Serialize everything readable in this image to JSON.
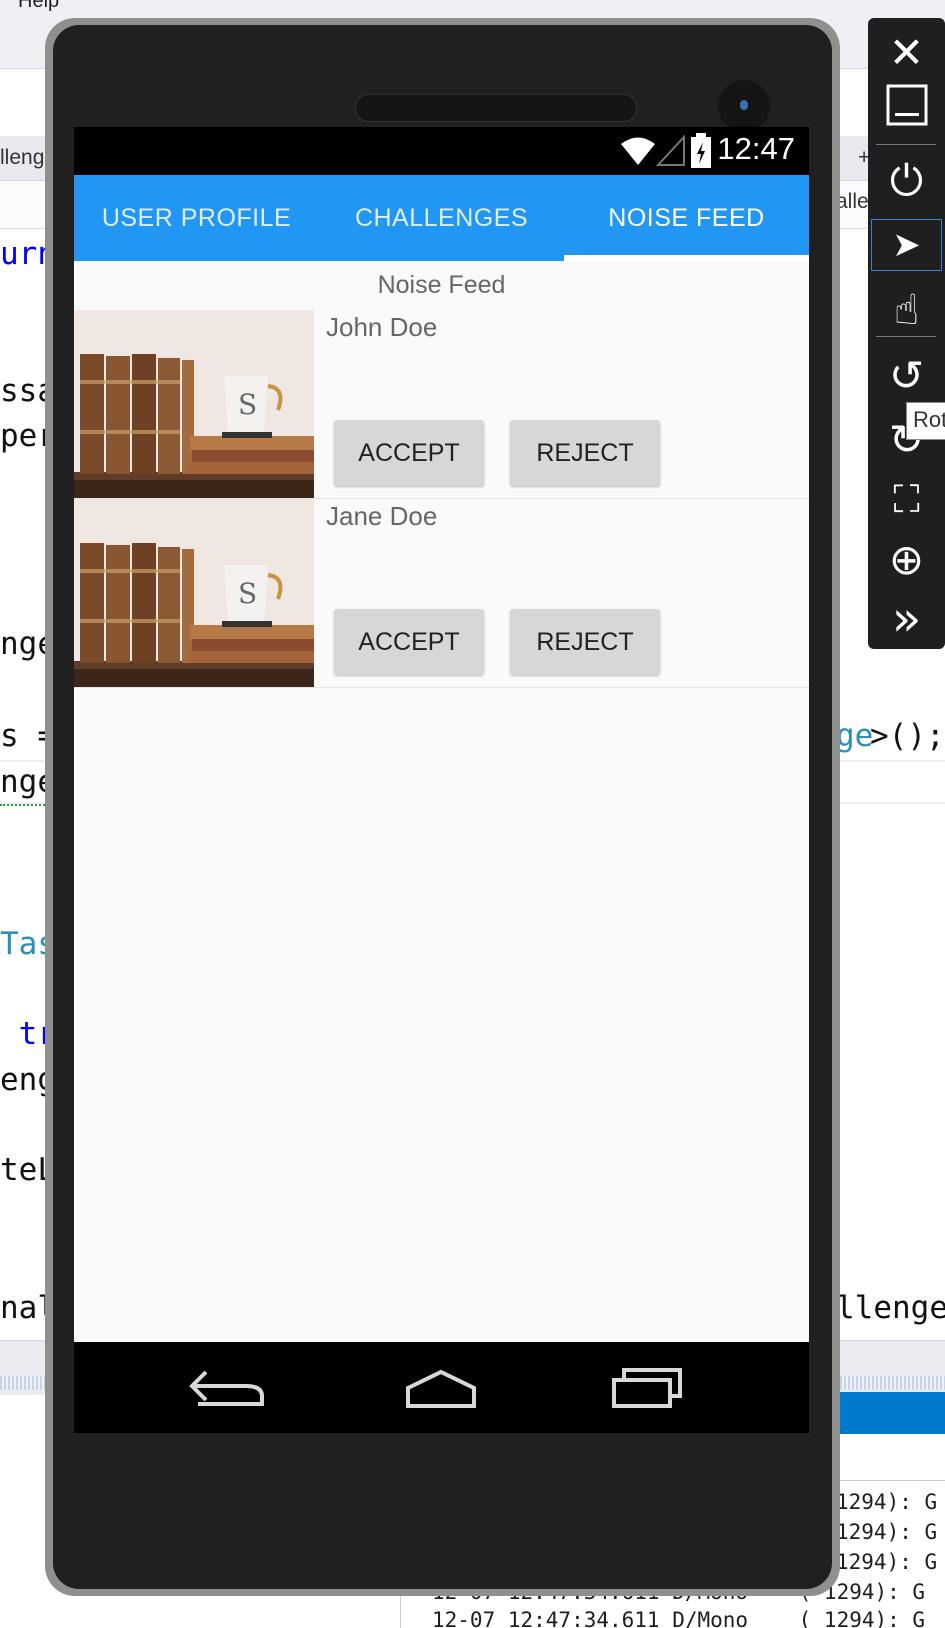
{
  "ide": {
    "menu_label": "Help",
    "tab_left": "lleng",
    "tab_right": "+",
    "nav_right": "alle",
    "code_lines": [
      {
        "text": "urn",
        "color": "blue",
        "side": "left"
      },
      {
        "text": "ssa",
        "color": "black",
        "side": "left"
      },
      {
        "text": "per",
        "color": "black",
        "side": "left"
      },
      {
        "text": "nge",
        "color": "black",
        "side": "left"
      },
      {
        "text": "s =",
        "color": "black",
        "side": "left"
      },
      {
        "text": "nge",
        "color": "black",
        "side": "left"
      },
      {
        "text": "Tas",
        "color": "teal",
        "side": "left"
      },
      {
        "text": " tr",
        "color": "blue",
        "side": "left"
      },
      {
        "text": "eng",
        "color": "black",
        "side": "left"
      },
      {
        "text": "teL",
        "color": "black",
        "side": "left"
      },
      {
        "text": "nal",
        "color": "black",
        "side": "left"
      }
    ],
    "code_right_1_teal": "ge",
    "code_right_1_black": ">();",
    "code_right_2": "llenge",
    "output_lines": [
      "1294): G",
      "1294): G",
      "1294): G",
      "12-07 12:47:34.611 D/Mono    ( 1294): G",
      "12-07 12:47:34.611 D/Mono    ( 1294): G"
    ],
    "tooltip": "Rot"
  },
  "toolbar": {
    "buttons": [
      {
        "name": "close-icon",
        "glyph": "✕"
      },
      {
        "name": "minimize-icon",
        "glyph": "▁"
      },
      {
        "name": "power-icon",
        "glyph": "⏻"
      },
      {
        "name": "pointer-icon",
        "glyph": "➤"
      },
      {
        "name": "touch-icon",
        "glyph": "☝"
      },
      {
        "name": "rotate-left-icon",
        "glyph": "↺"
      },
      {
        "name": "rotate-right-icon",
        "glyph": "↻"
      },
      {
        "name": "fit-screen-icon",
        "glyph": "⛶"
      },
      {
        "name": "zoom-icon",
        "glyph": "⊕"
      },
      {
        "name": "more-icon",
        "glyph": "»"
      }
    ]
  },
  "device": {
    "status_time": "12:47",
    "tabs": [
      {
        "label": "USER PROFILE",
        "active": false
      },
      {
        "label": "CHALLENGES",
        "active": false
      },
      {
        "label": "NOISE FEED",
        "active": true
      }
    ],
    "feed_title": "Noise Feed",
    "feed_items": [
      {
        "name": "John Doe",
        "accept_label": "ACCEPT",
        "reject_label": "REJECT"
      },
      {
        "name": "Jane Doe",
        "accept_label": "ACCEPT",
        "reject_label": "REJECT"
      }
    ],
    "accent_color": "#2196f3"
  }
}
